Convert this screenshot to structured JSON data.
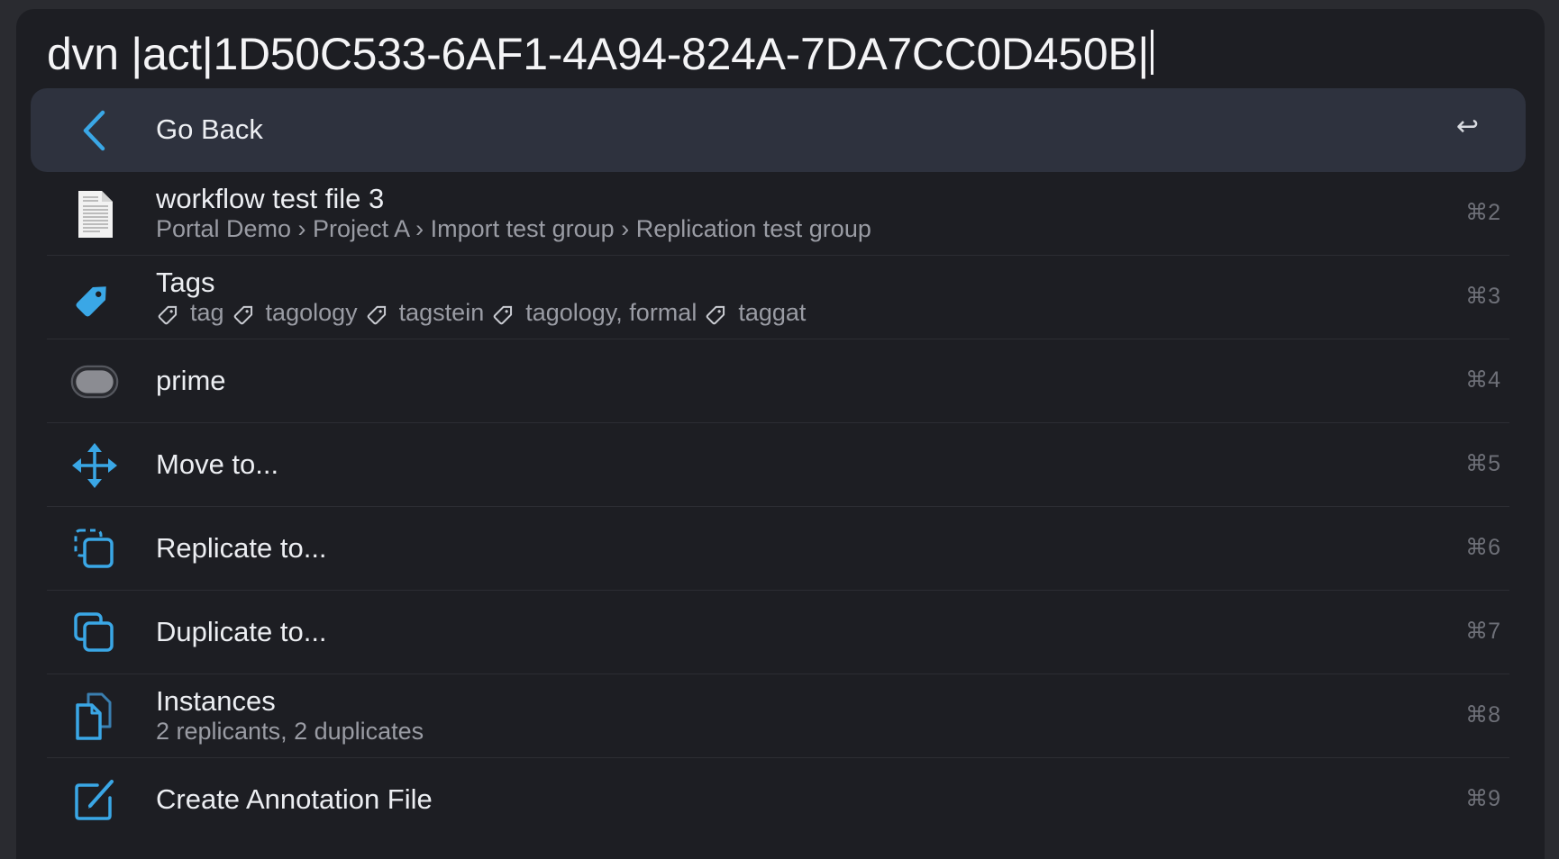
{
  "query": "dvn |act|1D50C533-6AF1-4A94-824A-7DA7CC0D450B|",
  "items": [
    {
      "icon": "chevron-left-icon",
      "title": "Go Back",
      "shortcut": "↩",
      "selected": true
    },
    {
      "icon": "document-icon",
      "title": "workflow test file 3",
      "subtitle": "Portal Demo › Project A › Import test group › Replication test group",
      "shortcut": "⌘2"
    },
    {
      "icon": "tag-icon",
      "title": "Tags",
      "tags": [
        "tag",
        "tagology",
        "tagstein",
        "tagology, formal",
        "taggat"
      ],
      "shortcut": "⌘3"
    },
    {
      "icon": "label-pill-icon",
      "title": "prime",
      "shortcut": "⌘4"
    },
    {
      "icon": "move-arrows-icon",
      "title": "Move to...",
      "shortcut": "⌘5"
    },
    {
      "icon": "replicate-icon",
      "title": "Replicate to...",
      "shortcut": "⌘6"
    },
    {
      "icon": "duplicate-icon",
      "title": "Duplicate to...",
      "shortcut": "⌘7"
    },
    {
      "icon": "instances-icon",
      "title": "Instances",
      "subtitle": "2 replicants, 2 duplicates",
      "shortcut": "⌘8"
    },
    {
      "icon": "annotation-pencil-icon",
      "title": "Create Annotation File",
      "shortcut": "⌘9"
    }
  ],
  "colors": {
    "accent": "#3aa7e6",
    "background": "#1d1e23",
    "selected_row": "#2e323e"
  }
}
